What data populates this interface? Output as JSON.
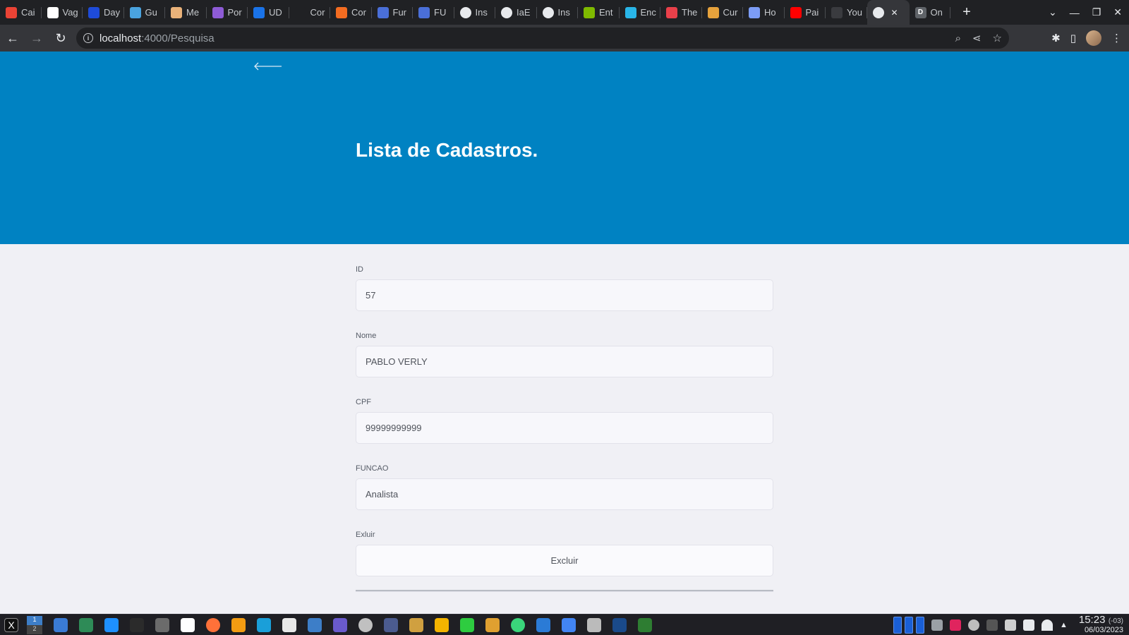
{
  "browser": {
    "tabs": [
      {
        "label": "Cai",
        "icon": "gmail-icon",
        "color": "#ea4335"
      },
      {
        "label": "Vag",
        "icon": "tab-t-icon",
        "color": "#ffffff"
      },
      {
        "label": "Day",
        "icon": "tab-d-icon",
        "color": "#1e4bd8"
      },
      {
        "label": "Gu",
        "icon": "tab-gear-icon",
        "color": "#4aa3df"
      },
      {
        "label": "Me",
        "icon": "hammer-icon",
        "color": "#e9b27a"
      },
      {
        "label": "Por",
        "icon": "tab-k-icon",
        "color": "#8e5bd6"
      },
      {
        "label": "UD",
        "icon": "tab-udemy-icon",
        "color": "#1a73e8"
      },
      {
        "label": "Cor",
        "icon": "blank-icon",
        "color": "#202124"
      },
      {
        "label": "Cor",
        "icon": "swirl-icon",
        "color": "#f36c21"
      },
      {
        "label": "Fur",
        "icon": "arrow-left-tab-icon",
        "color": "#4a6fd8"
      },
      {
        "label": "FU",
        "icon": "arrow-left-tab-icon",
        "color": "#4a6fd8"
      },
      {
        "label": "Ins",
        "icon": "globe-icon",
        "color": "#e8eaed"
      },
      {
        "label": "IaE",
        "icon": "globe-icon",
        "color": "#e8eaed"
      },
      {
        "label": "Ins",
        "icon": "globe-icon",
        "color": "#e8eaed"
      },
      {
        "label": "Ent",
        "icon": "microsoft-icon",
        "color": "#7fba00"
      },
      {
        "label": "Enc",
        "icon": "snowflake-icon",
        "color": "#29b5e8"
      },
      {
        "label": "The",
        "icon": "tab-p-icon",
        "color": "#e9404a"
      },
      {
        "label": "Cur",
        "icon": "graduation-icon",
        "color": "#e6a23c"
      },
      {
        "label": "Ho",
        "icon": "sparkle-icon",
        "color": "#7c9cf5"
      },
      {
        "label": "Pai",
        "icon": "youtube-icon",
        "color": "#ff0000"
      },
      {
        "label": "You",
        "icon": "github-icon",
        "color": "#3a3b3f"
      }
    ],
    "active_tab": {
      "icon": "globe-icon",
      "close": "✕"
    },
    "last_tab": {
      "label": "On",
      "icon": "tab-d-icon",
      "color": "#5f6368"
    },
    "new_tab": "+",
    "url_host": "localhost",
    "url_path": ":4000/Pesquisa"
  },
  "page": {
    "title": "Lista de Cadastros.",
    "header_color": "#0082c2"
  },
  "form": {
    "id_label": "ID",
    "id_value": "57",
    "nome_label": "Nome",
    "nome_value": "PABLO VERLY",
    "cpf_label": "CPF",
    "cpf_value": "99999999999",
    "funcao_label": "FUNCAO",
    "funcao_value": "Analista",
    "excluir_label": "Exluir",
    "excluir_button": "Excluir"
  },
  "taskbar": {
    "workspaces": [
      "1",
      "2"
    ],
    "time": "15:23",
    "timezone": "(-03)",
    "date": "06/03/2023",
    "icons": [
      "#3a7bd5",
      "#2e8b57",
      "#1e90ff",
      "#2b2b2b",
      "#6b6b6b",
      "#ffffff",
      "#ff7139",
      "#f39c12",
      "#1a9fd9",
      "#e8e8e8",
      "#3d7ec8",
      "#6a5acd",
      "#c0c0c0",
      "#4b5b8f",
      "#d0a040",
      "#f4b400",
      "#2ecc40",
      "#e0a030",
      "#3ad67b",
      "#2b7bd6",
      "#4285f4",
      "#bbbbbb",
      "#1a4a8a",
      "#2e7d32"
    ]
  }
}
